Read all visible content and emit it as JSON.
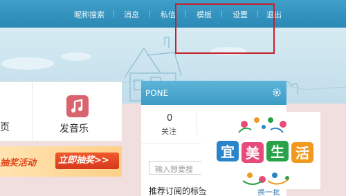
{
  "nav": {
    "items": [
      "昵称搜索",
      "消息",
      "私信",
      "模板",
      "设置",
      "退出"
    ]
  },
  "left": {
    "fragment_label": "页",
    "music_label": "发音乐",
    "banner_text": "抽奖活动",
    "banner_button": "立即抽奖>>"
  },
  "panel": {
    "title": "PONE",
    "stat_count": "0",
    "stat_label": "关注",
    "search_placeholder": "输入想要搜",
    "recommend_title": "推荐订阅的标签",
    "refresh_label": "换一批"
  },
  "logo": {
    "text": "宜美生活",
    "colors": [
      "#2a84c9",
      "#e84a7a",
      "#2aa24a",
      "#f19a1f"
    ]
  },
  "colors": {
    "topbar": "#3f9fc9",
    "highlight": "#c8202a",
    "banner_button": "#e0461a"
  },
  "icons": [
    "gear-icon",
    "music-icon",
    "house-illustration"
  ]
}
